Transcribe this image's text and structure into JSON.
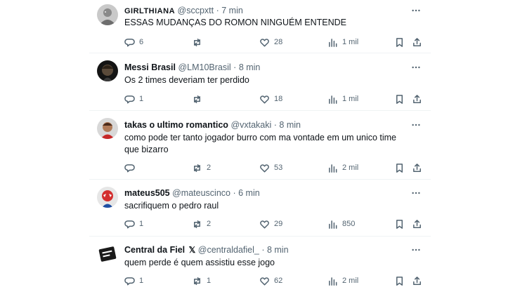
{
  "tweets": [
    {
      "name": "GIRLTHIANA",
      "handle": "@sccpxtt",
      "time": "7 min",
      "text": "ESSAS MUDANÇAS DO ROMON NINGUÉM ENTENDE",
      "stats": {
        "replies": "6",
        "reposts": "",
        "likes": "28",
        "views": "1 mil"
      }
    },
    {
      "name": "Messi Brasil",
      "handle": "@LM10Brasil",
      "time": "8 min",
      "text": "Os 2 times deveriam ter perdido",
      "stats": {
        "replies": "1",
        "reposts": "",
        "likes": "18",
        "views": "1 mil"
      }
    },
    {
      "name": "takas o ultimo romantico",
      "handle": "@vxtakaki",
      "time": "8 min",
      "text": "como pode ter tanto jogador burro com ma vontade em um unico time que bizarro",
      "stats": {
        "replies": "",
        "reposts": "2",
        "likes": "53",
        "views": "2 mil"
      }
    },
    {
      "name": "mateus505",
      "handle": "@mateuscinco",
      "time": "6 min",
      "text": "sacrifiquem o pedro raul",
      "stats": {
        "replies": "1",
        "reposts": "2",
        "likes": "29",
        "views": "850"
      }
    },
    {
      "name": "Central da Fiel",
      "badge": "𝕏",
      "handle": "@centraldafiel_",
      "time": "8 min",
      "text": "quem perde é quem assistiu esse jogo",
      "stats": {
        "replies": "1",
        "reposts": "1",
        "likes": "62",
        "views": "2 mil"
      }
    }
  ],
  "separator": "·",
  "icons": [
    "more-icon",
    "reply-icon",
    "repost-icon",
    "like-icon",
    "views-icon",
    "bookmark-icon",
    "share-icon"
  ],
  "colors": {
    "text": "#0f1419",
    "meta": "#536471",
    "divider": "#eff3f4"
  }
}
